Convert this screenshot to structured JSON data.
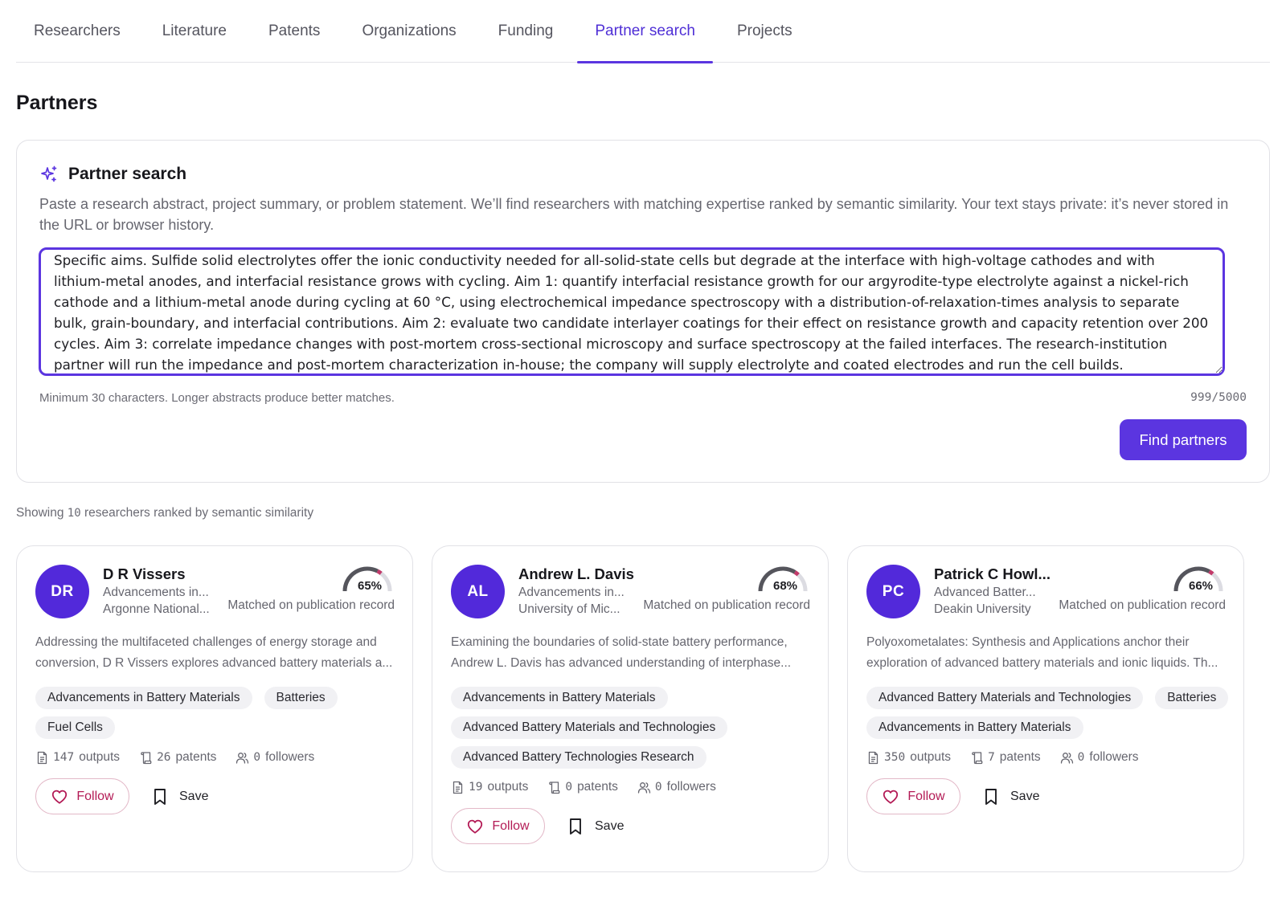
{
  "tabs": [
    {
      "label": "Researchers",
      "active": false
    },
    {
      "label": "Literature",
      "active": false
    },
    {
      "label": "Patents",
      "active": false
    },
    {
      "label": "Organizations",
      "active": false
    },
    {
      "label": "Funding",
      "active": false
    },
    {
      "label": "Partner search",
      "active": true
    },
    {
      "label": "Projects",
      "active": false
    }
  ],
  "page": {
    "title": "Partners"
  },
  "search": {
    "title": "Partner search",
    "description": "Paste a research abstract, project summary, or problem statement. We’ll find researchers with matching expertise ranked by semantic similarity. Your text stays private: it’s never stored in the URL or browser history.",
    "query": "Specific aims. Sulfide solid electrolytes offer the ionic conductivity needed for all-solid-state cells but degrade at the interface with high-voltage cathodes and with lithium-metal anodes, and interfacial resistance grows with cycling. Aim 1: quantify interfacial resistance growth for our argyrodite-type electrolyte against a nickel-rich cathode and a lithium-metal anode during cycling at 60 °C, using electrochemical impedance spectroscopy with a distribution-of-relaxation-times analysis to separate bulk, grain-boundary, and interfacial contributions. Aim 2: evaluate two candidate interlayer coatings for their effect on resistance growth and capacity retention over 200 cycles. Aim 3: correlate impedance changes with post-mortem cross-sectional microscopy and surface spectroscopy at the failed interfaces. The research-institution partner will run the impedance and post-mortem characterization in-house; the company will supply electrolyte and coated electrodes and run the cell builds.",
    "hint": "Minimum 30 characters. Longer abstracts produce better matches.",
    "counter": "999/5000",
    "button_label": "Find partners",
    "accent_color": "#5b35e0"
  },
  "results": {
    "prefix": "Showing",
    "count": "10",
    "suffix": "researchers ranked by semantic similarity"
  },
  "researchers": [
    {
      "initials": "DR",
      "name": "D R Vissers",
      "topic": "Advancements in...",
      "institution": "Argonne National...",
      "match_percent": 65,
      "match_label": "65%",
      "match_source": "Matched on publication record",
      "summary_line1": "Addressing the multifaceted challenges of energy storage and",
      "summary_line2": "conversion, D R Vissers explores advanced battery materials a...",
      "tags": [
        "Advancements in Battery Materials",
        "Batteries",
        "Fuel Cells"
      ],
      "outputs": "147",
      "outputs_label": "outputs",
      "patents": "26",
      "patents_label": "patents",
      "followers": "0",
      "followers_label": "followers",
      "follow_label": "Follow",
      "save_label": "Save"
    },
    {
      "initials": "AL",
      "name": "Andrew L. Davis",
      "topic": "Advancements in...",
      "institution": "University of Mic...",
      "match_percent": 68,
      "match_label": "68%",
      "match_source": "Matched on publication record",
      "summary_line1": "Examining the boundaries of solid-state battery performance,",
      "summary_line2": "Andrew L. Davis has advanced understanding of interphase...",
      "tags": [
        "Advancements in Battery Materials",
        "Advanced Battery Materials and Technologies",
        "Advanced Battery Technologies Research"
      ],
      "outputs": "19",
      "outputs_label": "outputs",
      "patents": "0",
      "patents_label": "patents",
      "followers": "0",
      "followers_label": "followers",
      "follow_label": "Follow",
      "save_label": "Save"
    },
    {
      "initials": "PC",
      "name": "Patrick C Howl...",
      "topic": "Advanced Batter...",
      "institution": "Deakin University",
      "match_percent": 66,
      "match_label": "66%",
      "match_source": "Matched on publication record",
      "summary_line1": "Polyoxometalates: Synthesis and Applications anchor their",
      "summary_line2": "exploration of advanced battery materials and ionic liquids. Th...",
      "tags": [
        "Advanced Battery Materials and Technologies",
        "Batteries",
        "Advancements in Battery Materials"
      ],
      "outputs": "350",
      "outputs_label": "outputs",
      "patents": "7",
      "patents_label": "patents",
      "followers": "0",
      "followers_label": "followers",
      "follow_label": "Follow",
      "save_label": "Save"
    }
  ],
  "colors": {
    "avatar": "#5229da",
    "gauge_track": "#dcdce2",
    "gauge_fill": "#55555c",
    "gauge_marker": "#c23a6a",
    "follow": "#b31a55"
  },
  "icons": {
    "search_title": "sparkles-icon",
    "outputs": "document-icon",
    "patents": "scroll-icon",
    "followers": "users-icon",
    "follow": "heart-icon",
    "save": "bookmark-icon"
  }
}
